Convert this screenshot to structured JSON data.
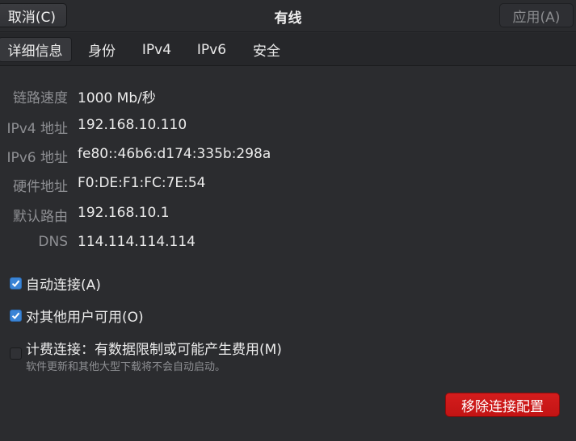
{
  "header": {
    "cancel_label": "取消(C)",
    "title": "有线",
    "apply_label": "应用(A)"
  },
  "tabs": [
    {
      "label": "详细信息",
      "active": true
    },
    {
      "label": "身份",
      "active": false
    },
    {
      "label": "IPv4",
      "active": false
    },
    {
      "label": "IPv6",
      "active": false
    },
    {
      "label": "安全",
      "active": false
    }
  ],
  "details": [
    {
      "label": "链路速度",
      "value": "1000 Mb/秒"
    },
    {
      "label": "IPv4 地址",
      "value": "192.168.10.110"
    },
    {
      "label": "IPv6 地址",
      "value": "fe80::46b6:d174:335b:298a"
    },
    {
      "label": "硬件地址",
      "value": "F0:DE:F1:FC:7E:54"
    },
    {
      "label": "默认路由",
      "value": "192.168.10.1"
    },
    {
      "label": "DNS",
      "value": "114.114.114.114"
    }
  ],
  "options": {
    "auto_connect": {
      "label": "自动连接(A)",
      "checked": true
    },
    "all_users": {
      "label": "对其他用户可用(O)",
      "checked": true
    },
    "metered": {
      "label": "计费连接：有数据限制或可能产生费用(M)",
      "sublabel": "软件更新和其他大型下载将不会自动启动。",
      "checked": false
    }
  },
  "remove_label": "移除连接配置",
  "colors": {
    "background": "#2b2c2f",
    "accent": "#3a84d6",
    "destructive": "#c8161a"
  }
}
